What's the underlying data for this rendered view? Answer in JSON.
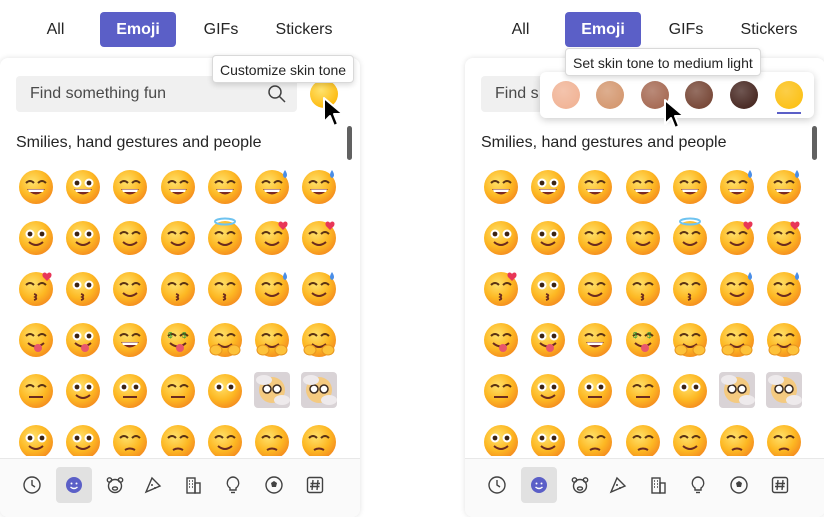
{
  "tabs": [
    "All",
    "Emoji",
    "GIFs",
    "Stickers"
  ],
  "active_tab": "Emoji",
  "left": {
    "search_placeholder": "Find something fun",
    "tooltip": "Customize skin tone",
    "section_title": "Smilies, hand gestures and people"
  },
  "right": {
    "search_placeholder": "Find s",
    "tooltip": "Set skin tone to medium light",
    "section_title": "Smilies, hand gestures and people",
    "skin_tones": [
      "#f1b598",
      "#d59a73",
      "#a86d57",
      "#7a4b3b",
      "#4b2c26",
      "#fcc21b"
    ],
    "selected_skin_tone": 5
  },
  "colors": {
    "accent": "#5b5fc7",
    "emoji_yellow": "#fdbd16"
  },
  "emoji_grid": [
    [
      "grinning-face",
      "grinning-big-eyes",
      "grinning-smiling-eyes",
      "beaming-face",
      "squinting-face",
      "sweat-smile",
      "sweat-grin"
    ],
    [
      "slightly-smiling",
      "upside-down-face",
      "winking-face",
      "smiling-eyes",
      "halo-face",
      "hearts-face",
      "heart-eyes"
    ],
    [
      "kissing-heart",
      "kissing-face",
      "relieved-smile",
      "kissing-closed-eyes",
      "kissing-smiling-eyes",
      "face-holding-back-tears",
      "tear-face"
    ],
    [
      "tongue-wink",
      "zany-face",
      "squinting-tongue",
      "money-mouth",
      "hugging-face",
      "hand-over-mouth",
      "peeking-eye"
    ],
    [
      "zipper-mouth",
      "raised-eyebrow",
      "neutral-face",
      "expressionless",
      "no-mouth",
      "face-in-clouds",
      "dotted-face"
    ],
    [
      "rolling-eyes",
      "grimacing",
      "exhaling",
      "unamused",
      "relieved",
      "pensive",
      "sleepy"
    ]
  ],
  "nav_icons": [
    "recent-icon",
    "smiley-icon",
    "animal-icon",
    "food-icon",
    "building-icon",
    "bulb-icon",
    "soccer-icon",
    "symbols-icon"
  ]
}
